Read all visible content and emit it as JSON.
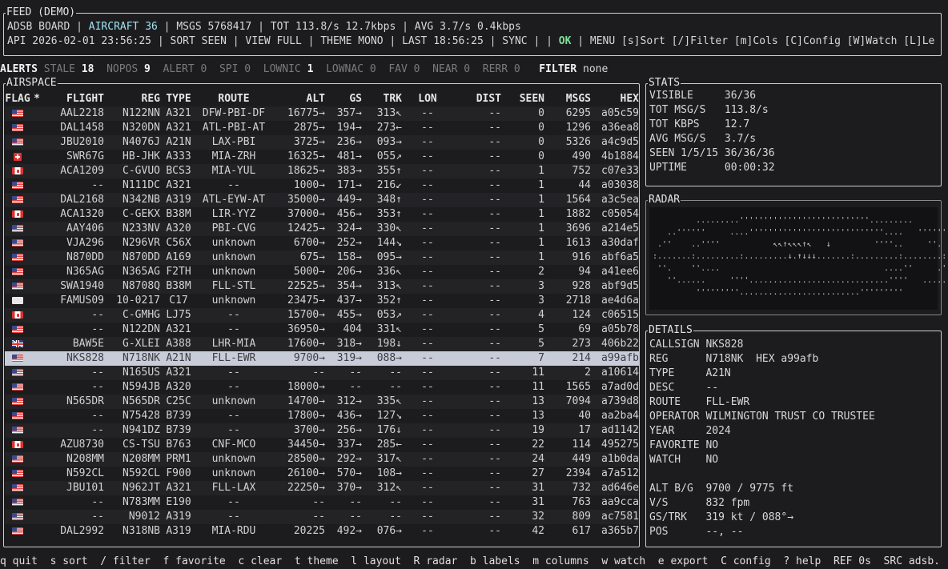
{
  "feed": {
    "title": "FEED (DEMO)",
    "board": "ADSB BOARD",
    "aircraft": "AIRCRAFT 36",
    "line1_rest": "MSGS 5768417 | TOT 113.8/s 12.7kbps | AVG 3.7/s 0.4kbps",
    "line2_a": "API 2026-02-01 23:56:25 | SORT SEEN | VIEW FULL | THEME MONO | LAST 18:56:25 | SYNC | |",
    "ok": "OK",
    "line2_b": "| MENU [s]Sort [/]Filter [m]Cols [C]Config [W]Watch [L]Le"
  },
  "alerts": {
    "label": "ALERTS",
    "items": [
      {
        "label": "STALE",
        "count": "18",
        "active": true
      },
      {
        "label": "NOPOS",
        "count": "9",
        "active": true
      },
      {
        "label": "ALERT",
        "count": "0",
        "active": false
      },
      {
        "label": "SPI",
        "count": "0",
        "active": false
      },
      {
        "label": "LOWNIC",
        "count": "1",
        "active": true
      },
      {
        "label": "LOWNAC",
        "count": "0",
        "active": false
      },
      {
        "label": "FAV",
        "count": "0",
        "active": false
      },
      {
        "label": "NEAR",
        "count": "0",
        "active": false
      },
      {
        "label": "RERR",
        "count": "0",
        "active": false
      }
    ],
    "filter_label": "FILTER",
    "filter_value": "none"
  },
  "airspace": {
    "title": "AIRSPACE",
    "columns": [
      "FLAG",
      "*",
      "FLIGHT",
      "REG",
      "TYPE",
      "ROUTE",
      "ALT",
      "GS",
      "TRK",
      "LON",
      "DIST",
      "SEEN",
      "MSGS",
      "HEX"
    ],
    "selected_index": 18,
    "rows": [
      [
        "us",
        "",
        "AAL2218",
        "N122NN",
        "A321",
        "DFW-PBI-DF",
        "16775→",
        "357→",
        "313↖",
        "--",
        "--",
        "0",
        "6295",
        "a05c59"
      ],
      [
        "us",
        "",
        "DAL1458",
        "N320DN",
        "A321",
        "ATL-PBI-AT",
        "2875→",
        "194→",
        "273←",
        "--",
        "--",
        "0",
        "1296",
        "a36ea8"
      ],
      [
        "us",
        "",
        "JBU2010",
        "N4076J",
        "A21N",
        "LAX-PBI",
        "3725→",
        "236→",
        "093→",
        "--",
        "--",
        "0",
        "5326",
        "a4c9d5"
      ],
      [
        "ch",
        "",
        "SWR67G",
        "HB-JHK",
        "A333",
        "MIA-ZRH",
        "16325→",
        "481→",
        "055↗",
        "--",
        "--",
        "0",
        "490",
        "4b1884"
      ],
      [
        "ca",
        "",
        "ACA1209",
        "C-GVUO",
        "BCS3",
        "MIA-YUL",
        "18625→",
        "383→",
        "355↑",
        "--",
        "--",
        "1",
        "752",
        "c07e33"
      ],
      [
        "us",
        "",
        "--",
        "N111DC",
        "A321",
        "--",
        "1000→",
        "171→",
        "216↙",
        "--",
        "--",
        "1",
        "44",
        "a03038"
      ],
      [
        "us",
        "",
        "DAL2168",
        "N342NB",
        "A319",
        "ATL-EYW-AT",
        "35000→",
        "449→",
        "348↑",
        "--",
        "--",
        "1",
        "1564",
        "a3c5ea"
      ],
      [
        "ca",
        "",
        "ACA1320",
        "C-GEKX",
        "B38M",
        "LIR-YYZ",
        "37000→",
        "456→",
        "353↑",
        "--",
        "--",
        "1",
        "1882",
        "c05054"
      ],
      [
        "us",
        "",
        "AAY406",
        "N233NV",
        "A320",
        "PBI-CVG",
        "12425→",
        "324→",
        "330↖",
        "--",
        "--",
        "1",
        "3696",
        "a214e5"
      ],
      [
        "us",
        "",
        "VJA296",
        "N296VR",
        "C56X",
        "unknown",
        "6700→",
        "252→",
        "144↘",
        "--",
        "--",
        "1",
        "1613",
        "a30daf"
      ],
      [
        "us",
        "",
        "N870DD",
        "N870DD",
        "A169",
        "unknown",
        "675→",
        "158→",
        "095→",
        "--",
        "--",
        "1",
        "916",
        "abf6a5"
      ],
      [
        "us",
        "",
        "N365AG",
        "N365AG",
        "F2TH",
        "unknown",
        "5000→",
        "206→",
        "336↖",
        "--",
        "--",
        "2",
        "94",
        "a41ee6"
      ],
      [
        "us",
        "",
        "SWA1940",
        "N8708Q",
        "B38M",
        "FLL-STL",
        "22525→",
        "354→",
        "313↖",
        "--",
        "--",
        "3",
        "928",
        "abf9d5"
      ],
      [
        "xx",
        "",
        "FAMUS09",
        "10-0217",
        "C17",
        "unknown",
        "23475→",
        "437→",
        "352↑",
        "--",
        "--",
        "3",
        "2718",
        "ae4d6a"
      ],
      [
        "ca",
        "",
        "--",
        "C-GMHG",
        "LJ75",
        "--",
        "15700→",
        "455→",
        "053↗",
        "--",
        "--",
        "4",
        "124",
        "c06515"
      ],
      [
        "us",
        "",
        "--",
        "N122DN",
        "A321",
        "--",
        "36950→",
        "404",
        "331↖",
        "--",
        "--",
        "5",
        "69",
        "a05b78"
      ],
      [
        "gb",
        "",
        "BAW5E",
        "G-XLEI",
        "A388",
        "LHR-MIA",
        "17600→",
        "318→",
        "198↓",
        "--",
        "--",
        "5",
        "273",
        "406b22"
      ],
      [
        "us",
        "",
        "NKS828",
        "N718NK",
        "A21N",
        "FLL-EWR",
        "9700→",
        "319→",
        "088→",
        "--",
        "--",
        "7",
        "214",
        "a99afb"
      ],
      [
        "us",
        "",
        "--",
        "N165US",
        "A321",
        "--",
        "--",
        "--",
        "--",
        "--",
        "--",
        "11",
        "2",
        "a10614"
      ],
      [
        "us",
        "",
        "--",
        "N594JB",
        "A320",
        "--",
        "18000→",
        "--",
        "--",
        "--",
        "--",
        "11",
        "1565",
        "a7ad0d"
      ],
      [
        "us",
        "",
        "N565DR",
        "N565DR",
        "C25C",
        "unknown",
        "14700→",
        "312→",
        "335↖",
        "--",
        "--",
        "13",
        "7094",
        "a739d8"
      ],
      [
        "us",
        "",
        "--",
        "N75428",
        "B739",
        "--",
        "17800→",
        "436→",
        "127↘",
        "--",
        "--",
        "13",
        "40",
        "aa2ba4"
      ],
      [
        "us",
        "",
        "--",
        "N941DZ",
        "B739",
        "--",
        "3700→",
        "256→",
        "176↓",
        "--",
        "--",
        "19",
        "17",
        "ad1142"
      ],
      [
        "ca",
        "",
        "AZU8730",
        "CS-TSU",
        "B763",
        "CNF-MCO",
        "34450→",
        "337→",
        "285←",
        "--",
        "--",
        "22",
        "114",
        "495275"
      ],
      [
        "us",
        "",
        "N208MM",
        "N208MM",
        "PRM1",
        "unknown",
        "28500→",
        "292→",
        "317↖",
        "--",
        "--",
        "24",
        "449",
        "a1b0da"
      ],
      [
        "us",
        "",
        "N592CL",
        "N592CL",
        "F900",
        "unknown",
        "26100→",
        "570→",
        "108→",
        "--",
        "--",
        "27",
        "2394",
        "a7a512"
      ],
      [
        "us",
        "",
        "JBU101",
        "N962JT",
        "A321",
        "FLL-LAX",
        "22250→",
        "370→",
        "312↖",
        "--",
        "--",
        "31",
        "732",
        "ad646e"
      ],
      [
        "us",
        "",
        "--",
        "N783MM",
        "E190",
        "--",
        "--",
        "--",
        "--",
        "--",
        "--",
        "31",
        "763",
        "aa9cca"
      ],
      [
        "us",
        "",
        "--",
        "N9012",
        "A319",
        "--",
        "--",
        "--",
        "--",
        "--",
        "--",
        "32",
        "809",
        "ac7581"
      ],
      [
        "us",
        "",
        "DAL2992",
        "N318NB",
        "A319",
        "MIA-RDU",
        "20225",
        "492→",
        "076→",
        "--",
        "--",
        "42",
        "617",
        "a365b7"
      ]
    ]
  },
  "stats": {
    "title": "STATS",
    "rows": [
      {
        "k": "VISIBLE",
        "v": "36/36"
      },
      {
        "k": "TOT MSG/S",
        "v": "113.8/s"
      },
      {
        "k": "TOT KBPS",
        "v": "12.7"
      },
      {
        "k": "AVG MSG/S",
        "v": "3.7/s"
      },
      {
        "k": "SEEN 1/5/15",
        "v": "36/36/36"
      },
      {
        "k": "UPTIME",
        "v": "00:00:32"
      }
    ]
  },
  "radar": {
    "title": "RADAR",
    "lines": [
      "         .........'''''''''''''''''''''''''''.........          ",
      "   ..''''''     ....''''''''''''''''''''''''''''....   '''''''..  ",
      " .''    ..''''           ↖↖↑↖↖↖↑↖   ↓         ''''..     ''. ",
      ":.......:.........:.........↓.↑↓↓↓.......:.........:........:",
      " ''.    ''....                                  ....''     .'' ",
      "   ''......     ''''.............................''''   ......''   ",
      "         '''''''''.........................'''''''''         "
    ]
  },
  "details": {
    "title": "DETAILS",
    "rows": [
      {
        "k": "CALLSIGN",
        "v": "NKS828"
      },
      {
        "k": "REG",
        "v": "N718NK  HEX a99afb"
      },
      {
        "k": "TYPE",
        "v": "A21N"
      },
      {
        "k": "DESC",
        "v": "--"
      },
      {
        "k": "ROUTE",
        "v": "FLL-EWR"
      },
      {
        "k": "OPERATOR",
        "v": "WILMINGTON TRUST CO TRUSTEE"
      },
      {
        "k": "YEAR",
        "v": "2024"
      },
      {
        "k": "FAVORITE",
        "v": "NO"
      },
      {
        "k": "WATCH",
        "v": "NO"
      },
      {
        "k": "",
        "v": ""
      },
      {
        "k": "ALT B/G",
        "v": "9700 / 9775 ft"
      },
      {
        "k": "V/S",
        "v": "832 fpm"
      },
      {
        "k": "GS/TRK",
        "v": "319 kt / 088°→"
      },
      {
        "k": "POS",
        "v": "--, --"
      }
    ]
  },
  "footer": {
    "text": "q quit  s sort  / filter  f favorite  c clear  t theme  l layout  R radar  b labels  m columns  w watch  e export  C config  ? help  REF 0s  SRC adsb."
  }
}
